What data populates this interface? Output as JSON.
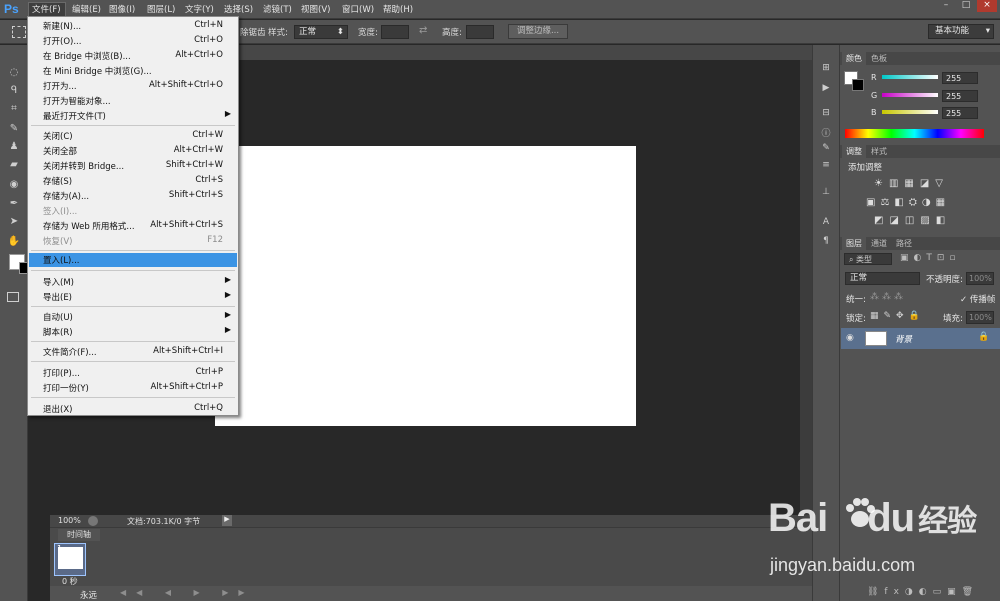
{
  "menubar": {
    "logo": "Ps",
    "items": [
      "文件(F)",
      "编辑(E)",
      "图像(I)",
      "图层(L)",
      "文字(Y)",
      "选择(S)",
      "滤镜(T)",
      "视图(V)",
      "窗口(W)",
      "帮助(H)"
    ],
    "window_controls": [
      "–",
      "□",
      "×"
    ]
  },
  "options": {
    "style_label": "样式:",
    "style_value": "正常",
    "width_label": "宽度:",
    "height_label": "高度:",
    "refine_button": "调整边缘...",
    "workspace": "基本功能",
    "partial_label": "除锯齿"
  },
  "file_menu": {
    "items": [
      {
        "label": "新建(N)...",
        "shortcut": "Ctrl+N"
      },
      {
        "label": "打开(O)...",
        "shortcut": "Ctrl+O"
      },
      {
        "label": "在 Bridge 中浏览(B)...",
        "shortcut": "Alt+Ctrl+O"
      },
      {
        "label": "在 Mini Bridge 中浏览(G)...",
        "shortcut": ""
      },
      {
        "label": "打开为...",
        "shortcut": "Alt+Shift+Ctrl+O"
      },
      {
        "label": "打开为智能对象...",
        "shortcut": ""
      },
      {
        "label": "最近打开文件(T)",
        "shortcut": ""
      },
      {
        "label": "关闭(C)",
        "shortcut": "Ctrl+W"
      },
      {
        "label": "关闭全部",
        "shortcut": "Alt+Ctrl+W"
      },
      {
        "label": "关闭并转到 Bridge...",
        "shortcut": "Shift+Ctrl+W"
      },
      {
        "label": "存储(S)",
        "shortcut": "Ctrl+S"
      },
      {
        "label": "存储为(A)...",
        "shortcut": "Shift+Ctrl+S"
      },
      {
        "label": "签入(I)...",
        "shortcut": ""
      },
      {
        "label": "存储为 Web 所用格式...",
        "shortcut": "Alt+Shift+Ctrl+S"
      },
      {
        "label": "恢复(V)",
        "shortcut": "F12"
      },
      {
        "label": "置入(L)...",
        "shortcut": ""
      },
      {
        "label": "导入(M)",
        "shortcut": ""
      },
      {
        "label": "导出(E)",
        "shortcut": ""
      },
      {
        "label": "自动(U)",
        "shortcut": ""
      },
      {
        "label": "脚本(R)",
        "shortcut": ""
      },
      {
        "label": "文件简介(F)...",
        "shortcut": "Alt+Shift+Ctrl+I"
      },
      {
        "label": "打印(P)...",
        "shortcut": "Ctrl+P"
      },
      {
        "label": "打印一份(Y)",
        "shortcut": "Alt+Shift+Ctrl+P"
      },
      {
        "label": "退出(X)",
        "shortcut": "Ctrl+Q"
      }
    ]
  },
  "status": {
    "zoom": "100%",
    "doc_info": "文档:703.1K/0 字节"
  },
  "timeline": {
    "tab": "时间轴",
    "frame_number": "1",
    "frame_delay": "0 秒",
    "loop": "永远"
  },
  "color_panel": {
    "tabs": [
      "颜色",
      "色板"
    ],
    "channels": [
      {
        "name": "R",
        "value": "255",
        "color": "#00c8c8"
      },
      {
        "name": "G",
        "value": "255",
        "color": "#c800c8"
      },
      {
        "name": "B",
        "value": "255",
        "color": "#c8c800"
      }
    ]
  },
  "adjust_panel": {
    "tabs": [
      "调整",
      "样式"
    ],
    "title": "添加调整"
  },
  "layers_panel": {
    "tabs": [
      "图层",
      "通道",
      "路径"
    ],
    "filter": "类型",
    "blend_mode": "正常",
    "opacity_label": "不透明度:",
    "opacity_value": "100%",
    "unify_label": "统一:",
    "propagate_label": "传播帧",
    "lock_label": "锁定:",
    "fill_label": "填充:",
    "fill_value": "100%",
    "layer_name": "背景"
  },
  "watermark": {
    "logo_text": "Bai",
    "logo_text2": "du",
    "cn": "经验",
    "url": "jingyan.baidu.com"
  }
}
